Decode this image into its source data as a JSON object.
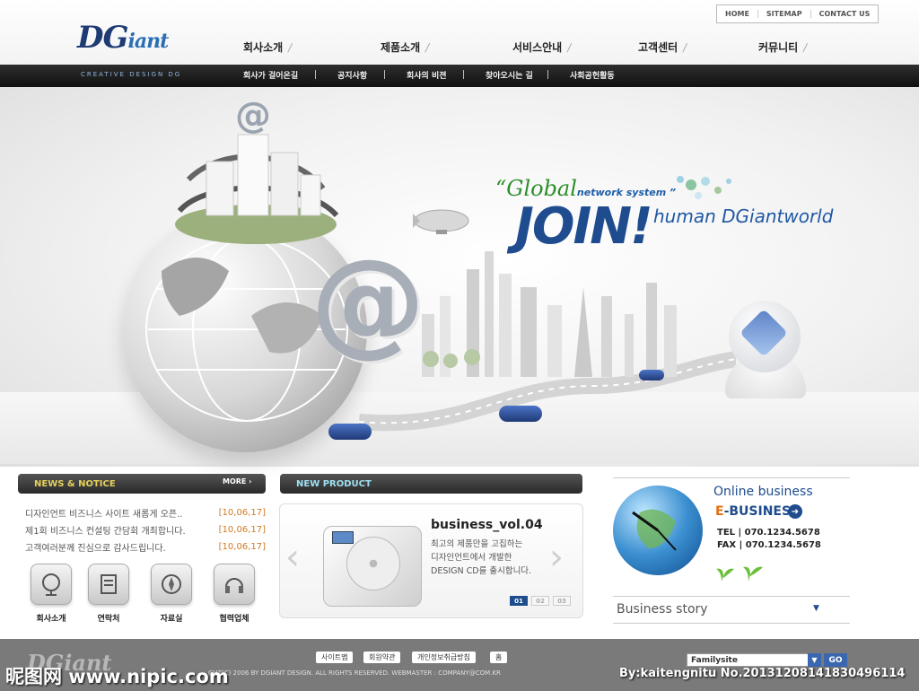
{
  "header": {
    "logo_main": "DG",
    "logo_rest": "iant",
    "util_links": [
      "HOME",
      "SITEMAP",
      "CONTACT US"
    ],
    "main_nav": [
      "회사소개",
      "제품소개",
      "서비스안내",
      "고객센터",
      "커뮤니티"
    ],
    "tagline": "CREATIVE DESIGN DG",
    "sub_nav": [
      "회사가 걸어온길",
      "공지사항",
      "회사의 비젼",
      "찾아오시는 길",
      "사회공헌활동"
    ]
  },
  "hero": {
    "quote": "“Global",
    "quote_small": "network system ”",
    "join": "JOIN!",
    "join_sub": "human DGiantworld",
    "at_symbol": "@"
  },
  "news": {
    "title": "NEWS & NOTICE",
    "more_label": "MORE ›",
    "items": [
      {
        "text": "디자인언트 비즈니스 사이트 새롭게 오픈..",
        "date": "[10,06,17]"
      },
      {
        "text": "제1회 비즈니스 컨설팅 간담회 개최합니다.",
        "date": "[10,06,17]"
      },
      {
        "text": "고객여러분께 진심으로 감사드립니다.",
        "date": "[10,06,17]"
      }
    ]
  },
  "quick_links": [
    {
      "label": "회사소개",
      "icon": "globe-icon"
    },
    {
      "label": "연락처",
      "icon": "notepad-icon"
    },
    {
      "label": "자료실",
      "icon": "compass-icon"
    },
    {
      "label": "협력업체",
      "icon": "headset-icon"
    }
  ],
  "product": {
    "title": "NEW PRODUCT",
    "name": "business_vol.04",
    "desc_line1": "최고의 제품만을 고집하는",
    "desc_line2": "디자인언트에서 개발한",
    "desc_line3": "DESIGN CD를 출시합니다.",
    "pages": [
      "01",
      "02",
      "03"
    ],
    "arrow_left": "‹",
    "arrow_right": "›"
  },
  "business": {
    "online": "Online business",
    "ebiz_e": "E",
    "ebiz_rest": "-BUSINESS",
    "arrow": "➜",
    "tel": "TEL | 070.1234.5678",
    "fax": "FAX | 070.1234.5678",
    "story": "Business story",
    "story_arrow": "▼"
  },
  "footer": {
    "logo": "DGiant",
    "buttons": [
      "사이트맵",
      "회원약관",
      "개인정보취급방침",
      "홈"
    ],
    "copyright": "GHT(C) 2006 BY DGIANT DESIGN. ALL RIGHTS RESERVED. WEBMASTER : COMPANY@COM.KR",
    "family_site": "Familysite",
    "family_arrow": "▼",
    "go": "GO"
  },
  "watermark": {
    "left": "昵图网 www.nipic.com",
    "right": "By:kaitengnitu  No.20131208141830496114"
  },
  "colors": {
    "brand_blue": "#1e4c8e",
    "accent_orange": "#d07a20",
    "dark_bar": "#1a1a1a"
  }
}
